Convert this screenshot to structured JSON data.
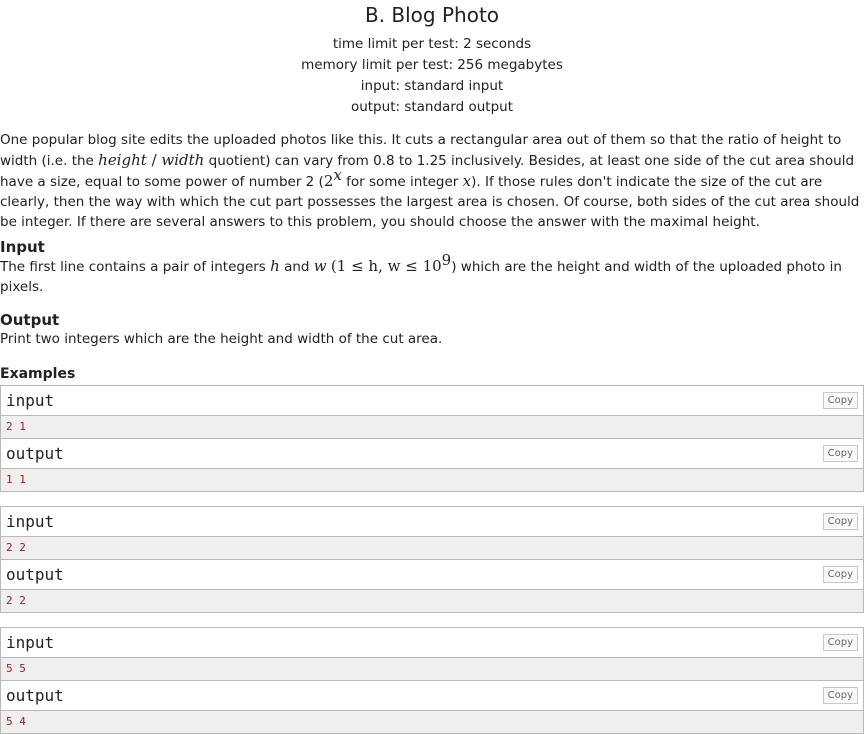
{
  "problem": {
    "title": "B. Blog Photo",
    "time_limit": "time limit per test: 2 seconds",
    "memory_limit": "memory limit per test: 256 megabytes",
    "input_file": "input: standard input",
    "output_file": "output: standard output"
  },
  "legend": {
    "t1": "One popular blog site edits the uploaded photos like this. It cuts a rectangular area out of them so that the ratio of height to width (i.e. the",
    "m_height": "height",
    "m_slash": " / ",
    "m_width": "width",
    "t2": " quotient) can vary from 0.8 to 1.25 inclusively. Besides, at least one side of the cut area should have a size, equal to some power of number 2 (",
    "m_two": "2",
    "m_x_sup": "x",
    "t3": " for some integer ",
    "m_x": "x",
    "t4": "). If those rules don't indicate the size of the cut are clearly, then the way with which the cut part possesses the largest area is chosen. Of course, both sides of the cut area should be integer. If there are several answers to this problem, you should choose the answer with the maximal height."
  },
  "input_section": {
    "title": "Input",
    "t1": "The first line contains a pair of integers ",
    "m_h": "h",
    "t2": " and ",
    "m_w": "w",
    "m_constraint": "(1 ≤ h, w ≤ 10",
    "m_exp": "9",
    "m_close": ")",
    "t3": " which are the height and width of the uploaded photo in pixels."
  },
  "output_section": {
    "title": "Output",
    "text": "Print two integers which are the height and width of the cut area."
  },
  "examples": {
    "title": "Examples",
    "input_label": "input",
    "output_label": "output",
    "copy_label": "Copy",
    "tests": [
      {
        "input": "2 1",
        "output": "1 1"
      },
      {
        "input": "2 2",
        "output": "2 2"
      },
      {
        "input": "5 5",
        "output": "5 4"
      }
    ]
  }
}
